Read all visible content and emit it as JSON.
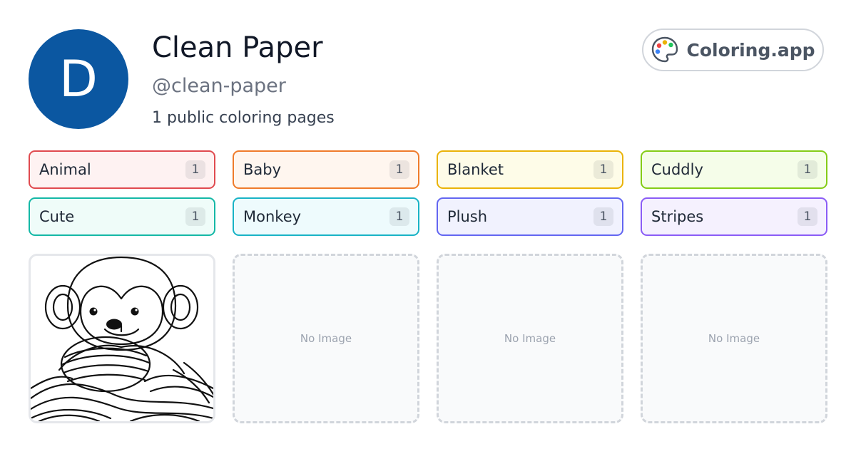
{
  "profile": {
    "initial": "D",
    "avatar_color": "#0b57a1",
    "name": "Clean Paper",
    "handle": "@clean-paper",
    "page_count_text": "1 public coloring pages"
  },
  "brand": {
    "label": "Coloring.app",
    "icon": "palette-icon"
  },
  "tags": [
    {
      "label": "Animal",
      "count": "1",
      "border": "#e04a4f",
      "bg": "#fef2f2"
    },
    {
      "label": "Baby",
      "count": "1",
      "border": "#ef7b2b",
      "bg": "#fff6ef"
    },
    {
      "label": "Blanket",
      "count": "1",
      "border": "#eab308",
      "bg": "#fefce8"
    },
    {
      "label": "Cuddly",
      "count": "1",
      "border": "#84cc16",
      "bg": "#f5fde9"
    },
    {
      "label": "Cute",
      "count": "1",
      "border": "#14b8a6",
      "bg": "#effcf9"
    },
    {
      "label": "Monkey",
      "count": "1",
      "border": "#18b3c6",
      "bg": "#eefbfd"
    },
    {
      "label": "Plush",
      "count": "1",
      "border": "#6366f1",
      "bg": "#f1f2fe"
    },
    {
      "label": "Stripes",
      "count": "1",
      "border": "#8b5cf6",
      "bg": "#f5f1fe"
    }
  ],
  "cards": [
    {
      "type": "image",
      "subject": "monkey-plush-coloring-page"
    },
    {
      "type": "empty",
      "text": "No Image"
    },
    {
      "type": "empty",
      "text": "No Image"
    },
    {
      "type": "empty",
      "text": "No Image"
    }
  ]
}
